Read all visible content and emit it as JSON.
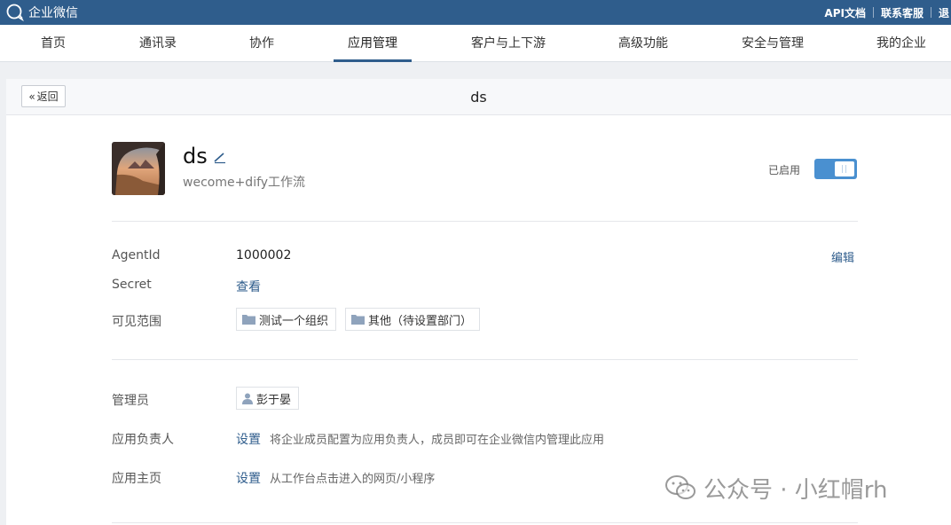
{
  "brand": {
    "name": "企业微信"
  },
  "top_links": [
    "API文档",
    "联系客服",
    "退"
  ],
  "nav": {
    "items": [
      {
        "label": "首页"
      },
      {
        "label": "通讯录"
      },
      {
        "label": "协作"
      },
      {
        "label": "应用管理",
        "active": true
      },
      {
        "label": "客户与上下游"
      },
      {
        "label": "高级功能"
      },
      {
        "label": "安全与管理"
      },
      {
        "label": "我的企业"
      }
    ]
  },
  "page": {
    "back_label": "返回",
    "title": "ds"
  },
  "app": {
    "name": "ds",
    "description": "wecome+dify工作流",
    "status_label": "已启用",
    "enabled": true
  },
  "details": {
    "agentid_label": "AgentId",
    "agentid_value": "1000002",
    "edit_label": "编辑",
    "secret_label": "Secret",
    "secret_action": "查看",
    "visibility_label": "可见范围",
    "visibility_tags": [
      "测试一个组织",
      "其他（待设置部门）"
    ],
    "admin_label": "管理员",
    "admin_name": "彭于晏",
    "owner_label": "应用负责人",
    "owner_action": "设置",
    "owner_hint": "将企业成员配置为应用负责人，成员即可在企业微信内管理此应用",
    "homepage_label": "应用主页",
    "homepage_action": "设置",
    "homepage_hint": "从工作台点击进入的网页/小程序"
  },
  "watermark": {
    "text": "公众号 · 小红帽rh"
  },
  "colors": {
    "brand": "#2f5d8c",
    "toggle_on": "#4a90d0",
    "link": "#2f5d8c"
  }
}
